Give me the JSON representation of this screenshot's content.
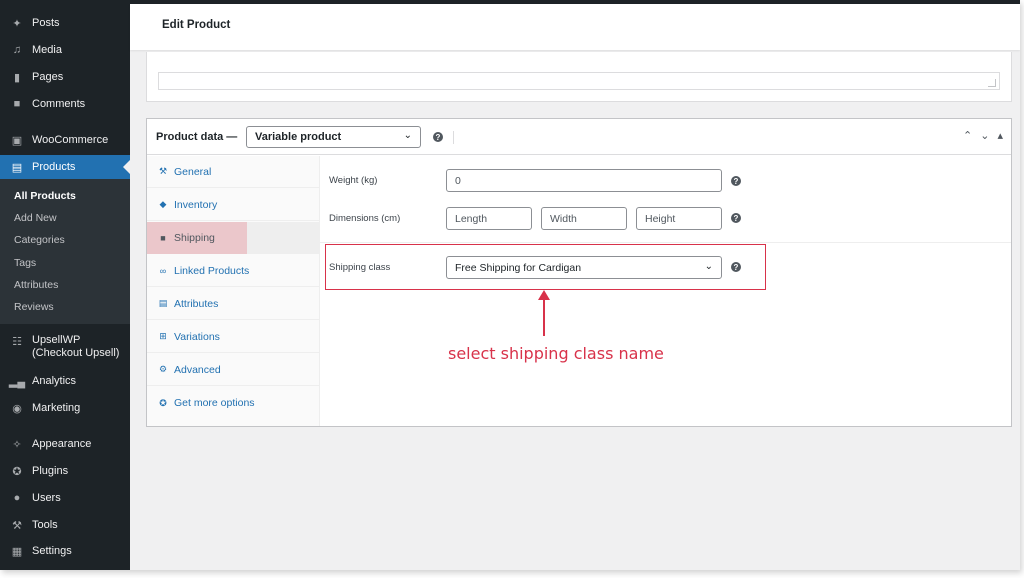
{
  "sidebar": {
    "items": [
      {
        "label": "Posts",
        "icon": "pin-icon"
      },
      {
        "label": "Media",
        "icon": "media-icon"
      },
      {
        "label": "Pages",
        "icon": "pages-icon"
      },
      {
        "label": "Comments",
        "icon": "comments-icon"
      },
      {
        "label": "WooCommerce",
        "icon": "woocommerce-icon"
      },
      {
        "label": "Products",
        "icon": "products-icon"
      },
      {
        "label": "UpsellWP (Checkout Upsell)",
        "icon": "cart-icon"
      },
      {
        "label": "Analytics",
        "icon": "analytics-icon"
      },
      {
        "label": "Marketing",
        "icon": "marketing-icon"
      },
      {
        "label": "Appearance",
        "icon": "appearance-icon"
      },
      {
        "label": "Plugins",
        "icon": "plugins-icon"
      },
      {
        "label": "Users",
        "icon": "users-icon"
      },
      {
        "label": "Tools",
        "icon": "tools-icon"
      },
      {
        "label": "Settings",
        "icon": "settings-icon"
      }
    ],
    "submenu": [
      "All Products",
      "Add New",
      "Categories",
      "Tags",
      "Attributes",
      "Reviews"
    ],
    "upsell_line1": "UpsellWP",
    "upsell_line2": "(Checkout Upsell)"
  },
  "header": {
    "title": "Edit Product"
  },
  "product_data": {
    "label": "Product data —",
    "type_value": "Variable product",
    "tabs": [
      "General",
      "Inventory",
      "Shipping",
      "Linked Products",
      "Attributes",
      "Variations",
      "Advanced",
      "Get more options"
    ],
    "active_tab": "Shipping",
    "weight_label": "Weight (kg)",
    "weight_placeholder": "0",
    "dimensions_label": "Dimensions (cm)",
    "length_placeholder": "Length",
    "width_placeholder": "Width",
    "height_placeholder": "Height",
    "shipping_class_label": "Shipping class",
    "shipping_class_value": "Free Shipping for Cardigan"
  },
  "annotation": {
    "text": "select shipping class name",
    "color": "#d8324a"
  },
  "colors": {
    "sidebar": "#1d2327",
    "accent": "#2271b1",
    "highlight": "#d8324a"
  }
}
